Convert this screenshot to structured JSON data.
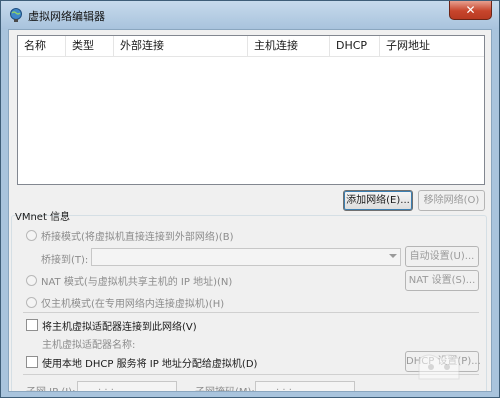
{
  "window": {
    "title": "虚拟网络编辑器",
    "close_symbol": "✕"
  },
  "network_list": {
    "columns": [
      "名称",
      "类型",
      "外部连接",
      "主机连接",
      "DHCP",
      "子网地址"
    ],
    "rows": []
  },
  "list_buttons": {
    "add_network": "添加网络(E)...",
    "remove_network": "移除网络(O)"
  },
  "vmnet_info": {
    "group_label": "VMnet 信息",
    "bridged_mode": "桥接模式(将虚拟机直接连接到外部网络)(B)",
    "bridged_to_label": "桥接到(T):",
    "bridged_to_value": "",
    "auto_settings_button": "自动设置(U)...",
    "nat_mode": "NAT 模式(与虚拟机共享主机的 IP 地址)(N)",
    "nat_settings_button": "NAT 设置(S)...",
    "host_only_mode": "仅主机模式(在专用网络内连接虚拟机)(H)",
    "connect_host_adapter": "将主机虚拟适配器连接到此网络(V)",
    "host_adapter_name_label": "主机虚拟适配器名称:",
    "use_dhcp": "使用本地 DHCP 服务将 IP 地址分配给虚拟机(D)",
    "dhcp_settings_button": "DHCP 设置(P)...",
    "subnet_ip_label": "子网 IP (I):",
    "subnet_mask_label": "子网掩码(M):",
    "ip_dots": ".      .      ."
  },
  "colors": {
    "title_bar": "#a8c3dd",
    "close_button": "#c7452c",
    "dialog_bg": "#f0f0f0"
  }
}
